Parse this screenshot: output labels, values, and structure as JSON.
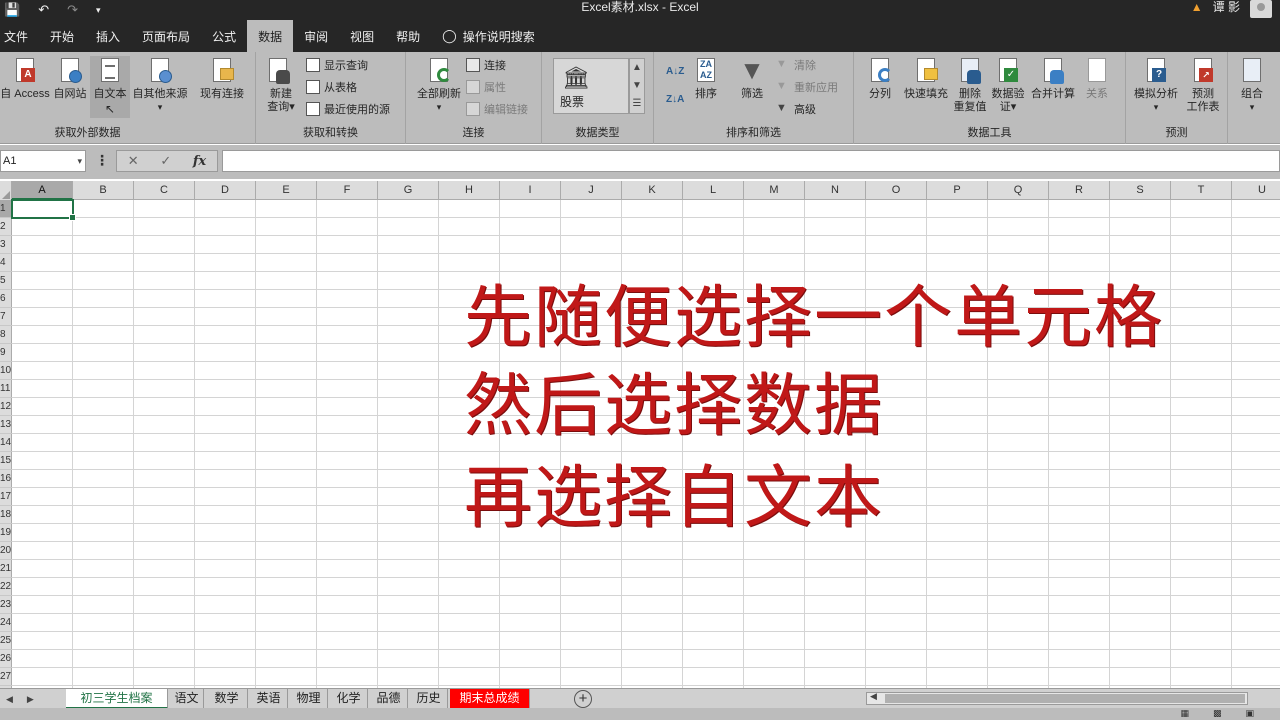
{
  "titlebar": {
    "title": "Excel素材.xlsx  -  Excel",
    "user": "谭 影",
    "icons": [
      "save-icon",
      "undo-icon",
      "redo-icon",
      "customize-qat-icon",
      "warning-icon"
    ]
  },
  "tabs": [
    "文件",
    "开始",
    "插入",
    "页面布局",
    "公式",
    "数据",
    "审阅",
    "视图",
    "帮助",
    "操作说明搜索"
  ],
  "active_tab": "数据",
  "ribbon": {
    "external": {
      "label": "获取外部数据",
      "access": "自 Access",
      "web": "自网站",
      "text": "自文本",
      "other": "自其他来源",
      "other_arrow": "▾",
      "existing": "现有连接"
    },
    "transform": {
      "label": "获取和转换",
      "new_query_1": "新建",
      "new_query_2": "查询",
      "show_queries": "显示查询",
      "from_table": "从表格",
      "recent_sources": "最近使用的源"
    },
    "connections": {
      "label": "连接",
      "refresh_all": "全部刷新",
      "connections": "连接",
      "properties": "属性",
      "edit_links": "编辑链接"
    },
    "data_types": {
      "label": "数据类型",
      "stocks": "股票"
    },
    "sort_filter": {
      "label": "排序和筛选",
      "sort": "排序",
      "filter": "筛选",
      "clear": "清除",
      "reapply": "重新应用",
      "advanced": "高级"
    },
    "data_tools": {
      "label": "数据工具",
      "text_to_columns": "分列",
      "flash_fill": "快速填充",
      "remove_dup_1": "删除",
      "remove_dup_2": "重复值",
      "validation_1": "数据验",
      "validation_2": "证",
      "consolidate": "合并计算",
      "relationships": "关系"
    },
    "forecast": {
      "label": "预测",
      "what_if": "模拟分析",
      "forecast_1": "预测",
      "forecast_2": "工作表"
    },
    "outline": {
      "group": "组合"
    }
  },
  "formula_bar": {
    "name_box": "A1",
    "fx": "fx",
    "cancel": "✕",
    "enter": "✓",
    "value": ""
  },
  "columns": [
    "A",
    "B",
    "C",
    "D",
    "E",
    "F",
    "G",
    "H",
    "I",
    "J",
    "K",
    "L",
    "M",
    "N",
    "O",
    "P",
    "Q",
    "R",
    "S",
    "T",
    "U"
  ],
  "rows": [
    "1",
    "2",
    "3",
    "4",
    "5",
    "6",
    "7",
    "8",
    "9",
    "10",
    "11",
    "12",
    "13",
    "14",
    "15",
    "16",
    "17",
    "18",
    "19",
    "20",
    "21",
    "22",
    "23",
    "24",
    "25",
    "26",
    "27"
  ],
  "active_cell": "A1",
  "overlay": {
    "line1": "先随便选择一个单元格",
    "line2": "然后选择数据",
    "line3": "再选择自文本",
    "color": "#c01818"
  },
  "sheets": [
    "初三学生档案",
    "语文",
    "数学",
    "英语",
    "物理",
    "化学",
    "品德",
    "历史",
    "期末总成绩"
  ],
  "active_sheet": "初三学生档案",
  "highlight_sheet_color": "#ff0000"
}
